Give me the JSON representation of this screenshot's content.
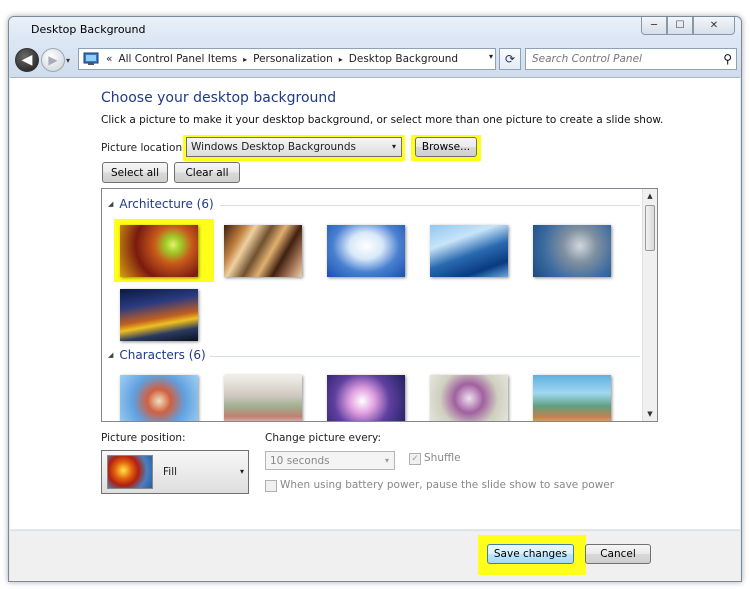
{
  "window": {
    "title": "Desktop Background",
    "caption_buttons": {
      "minimize": "─",
      "maximize": "☐",
      "close": "✕"
    }
  },
  "nav": {
    "back_icon": "◀",
    "forward_icon": "▶",
    "history_drop": "▾",
    "address_prefix": "«",
    "breadcrumb": [
      "All Control Panel Items",
      "Personalization",
      "Desktop Background"
    ],
    "chevron": "▸",
    "address_drop": "▾",
    "refresh_icon": "⟳",
    "search_placeholder": "Search Control Panel",
    "search_icon": "⚲"
  },
  "main": {
    "heading": "Choose your desktop background",
    "subtext": "Click a picture to make it your desktop background, or select more than one picture to create a slide show.",
    "picture_location_label": "Picture location:",
    "picture_location_value": "Windows Desktop Backgrounds",
    "dropdown_arrow": "▾",
    "browse_button": "Browse...",
    "select_all_button": "Select all",
    "clear_all_button": "Clear all"
  },
  "gallery": {
    "groups": [
      {
        "title": "Architecture (6)",
        "thumbnail_count": 6
      },
      {
        "title": "Characters (6)",
        "thumbnail_count": 6
      }
    ],
    "collapse_icon": "◢",
    "scroll_up": "▲",
    "scroll_down": "▼",
    "selected_group": "Architecture (6)",
    "selected_index": 0
  },
  "position": {
    "label": "Picture position:",
    "value": "Fill"
  },
  "slideshow": {
    "change_label": "Change picture every:",
    "change_value": "10 seconds",
    "shuffle_label": "Shuffle",
    "shuffle_checked": true,
    "battery_label": "When using battery power, pause the slide show to save power",
    "battery_checked": false,
    "check_mark": "✓"
  },
  "footer": {
    "save_button": "Save changes",
    "cancel_button": "Cancel"
  },
  "colors": {
    "highlight": "#ffff1a",
    "heading": "#1e3a8a"
  }
}
